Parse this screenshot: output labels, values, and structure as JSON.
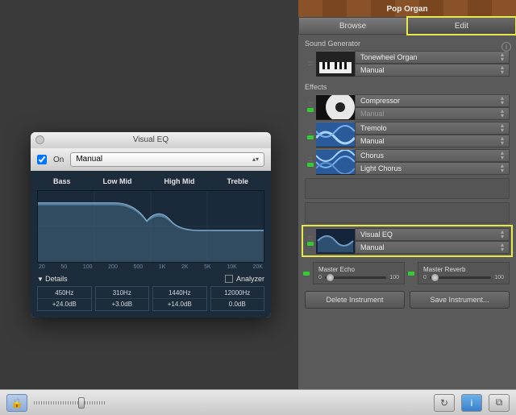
{
  "eq_window": {
    "title": "Visual EQ",
    "on_label": "On",
    "preset": "Manual",
    "bands": [
      "Bass",
      "Low Mid",
      "High Mid",
      "Treble"
    ],
    "xlabels": [
      "20",
      "50",
      "100",
      "200",
      "500",
      "1K",
      "2K",
      "5K",
      "10K",
      "20K"
    ],
    "details_label": "Details",
    "analyzer_label": "Analyzer",
    "values": [
      {
        "freq": "450Hz",
        "gain": "+24.0dB"
      },
      {
        "freq": "310Hz",
        "gain": "+3.0dB"
      },
      {
        "freq": "1440Hz",
        "gain": "+14.0dB"
      },
      {
        "freq": "12000Hz",
        "gain": "0.0dB"
      }
    ]
  },
  "panel": {
    "track_name": "Pop Organ",
    "tabs": {
      "browse": "Browse",
      "edit": "Edit"
    },
    "sound_generator_label": "Sound Generator",
    "generator": {
      "name": "Tonewheel Organ",
      "preset": "Manual"
    },
    "effects_label": "Effects",
    "effects": [
      {
        "name": "Compressor",
        "preset": "Manual",
        "dim": true
      },
      {
        "name": "Tremolo",
        "preset": "Manual",
        "dim": false
      },
      {
        "name": "Chorus",
        "preset": "Light Chorus",
        "dim": false
      }
    ],
    "visual_eq": {
      "name": "Visual EQ",
      "preset": "Manual"
    },
    "master_echo": {
      "label": "Master Echo",
      "min": "0",
      "max": "100"
    },
    "master_reverb": {
      "label": "Master Reverb",
      "min": "0",
      "max": "100"
    },
    "delete_btn": "Delete Instrument",
    "save_btn": "Save Instrument..."
  },
  "icons": {
    "lock": "🔒",
    "loop": "↻",
    "info": "i",
    "media": "⧉"
  }
}
